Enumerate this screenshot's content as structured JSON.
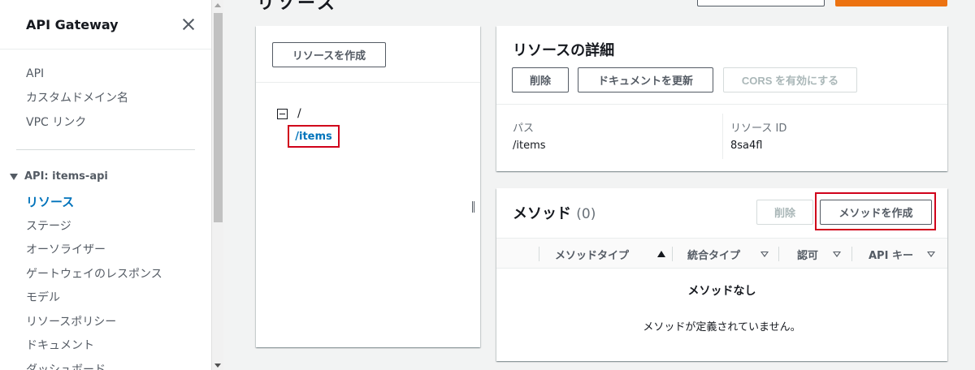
{
  "sidebar": {
    "title": "API Gateway",
    "top_links": [
      "API",
      "カスタムドメイン名",
      "VPC リンク"
    ],
    "api_section": "API: items-api",
    "api_links": [
      {
        "label": "リソース",
        "active": true
      },
      {
        "label": "ステージ",
        "active": false
      },
      {
        "label": "オーソライザー",
        "active": false
      },
      {
        "label": "ゲートウェイのレスポンス",
        "active": false
      },
      {
        "label": "モデル",
        "active": false
      },
      {
        "label": "リソースポリシー",
        "active": false
      },
      {
        "label": "ドキュメント",
        "active": false
      },
      {
        "label": "ダッシュボード",
        "active": false
      }
    ]
  },
  "header": {
    "heading_fragment": "リソース"
  },
  "tree": {
    "create_button": "リソースを作成",
    "root_label": "/",
    "child_label": "/items"
  },
  "details": {
    "title": "リソースの詳細",
    "delete_button": "削除",
    "update_doc_button": "ドキュメントを更新",
    "cors_button": "CORS を有効にする",
    "path_label": "パス",
    "path_value": "/items",
    "resource_id_label": "リソース ID",
    "resource_id_value": "8sa4fl"
  },
  "methods": {
    "title": "メソッド",
    "count": "(0)",
    "delete_button": "削除",
    "create_button": "メソッドを作成",
    "columns": [
      "メソッドタイプ",
      "統合タイプ",
      "認可",
      "API キー"
    ],
    "empty_title": "メソッドなし",
    "empty_description": "メソッドが定義されていません。"
  },
  "colors": {
    "accent_link": "#0073bb",
    "highlight_border": "#d0021b",
    "primary_orange": "#ec7211"
  }
}
